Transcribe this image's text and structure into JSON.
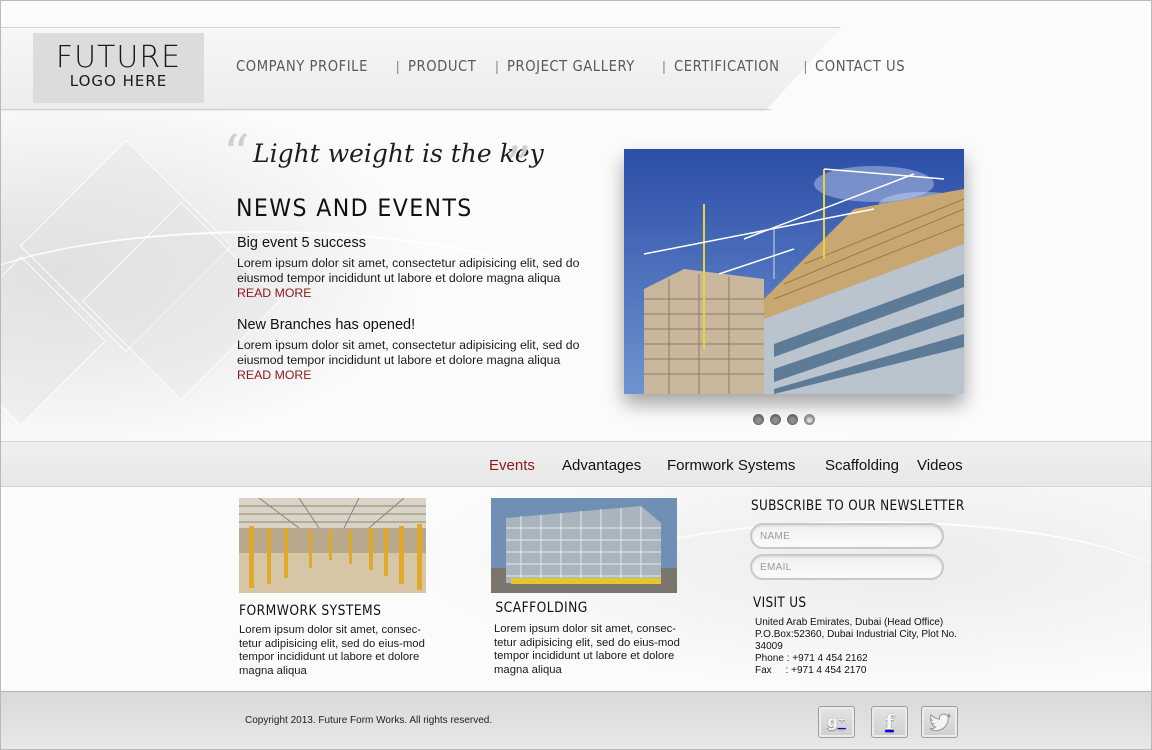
{
  "header": {
    "logo": {
      "line1": "FUTURE",
      "line2": "LOGO HERE"
    },
    "nav": [
      "COMPANY PROFILE",
      "PRODUCT",
      "PROJECT GALLERY",
      "CERTIFICATION",
      "CONTACT US"
    ]
  },
  "hero": {
    "quote": "Light weight is the key",
    "news_title": "NEWS AND EVENTS",
    "news": [
      {
        "title": "Big event 5 success",
        "body": "Lorem ipsum dolor sit amet, consectetur adipisicing elit, sed do eiusmod tempor incididunt ut labore et dolore magna aliqua",
        "link": "READ MORE"
      },
      {
        "title": "New Branches has opened!",
        "body": "Lorem ipsum dolor sit amet, consectetur adipisicing elit, sed do eiusmod tempor incididunt ut labore et dolore magna aliqua",
        "link": "READ MORE"
      }
    ],
    "slider": {
      "count": 4,
      "active": 4
    }
  },
  "subnav": {
    "items": [
      "Events",
      "Advantages",
      "Formwork Systems",
      "Scaffolding",
      "Videos"
    ],
    "active": "Events"
  },
  "cards": [
    {
      "title": "FORMWORK SYSTEMS",
      "body": "Lorem ipsum dolor sit amet, consec-tetur adipisicing elit, sed do eius-mod tempor incididunt ut labore et dolore magna aliqua"
    },
    {
      "title": "SCAFFOLDING",
      "body": "Lorem ipsum dolor sit amet, consec-tetur adipisicing elit, sed do eius-mod tempor incididunt ut labore et dolore magna aliqua"
    }
  ],
  "newsletter": {
    "title": "SUBSCRIBE TO OUR NEWSLETTER",
    "name_placeholder": "NAME",
    "email_placeholder": "EMAIL"
  },
  "visit": {
    "title": "VISIT US",
    "address_line1": "United Arab Emirates, Dubai (Head Office)",
    "address_line2": "P.O.Box:52360, Dubai Industrial City, Plot No.",
    "address_line3": "34009",
    "phone": "Phone : +971 4 454 2162",
    "fax": "Fax     : +971 4 454 2170"
  },
  "footer": {
    "copyright": "Copyright 2013. Future Form Works. All rights reserved.",
    "social": [
      "google-plus-icon",
      "facebook-icon",
      "twitter-icon"
    ]
  },
  "colors": {
    "accent": "#8b1a1a",
    "text": "#111111",
    "nav_text": "#5a5a5a",
    "footer_bg": "#dedede"
  }
}
